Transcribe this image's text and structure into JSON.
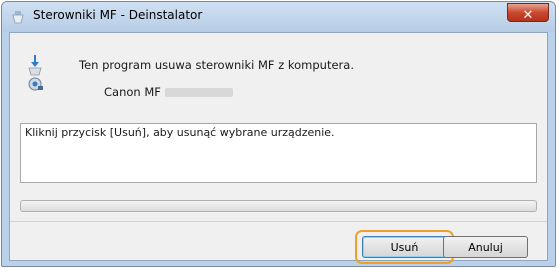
{
  "window": {
    "title": "Sterowniki MF - Deinstalator",
    "close_label": "✕"
  },
  "main": {
    "description": "Ten program usuwa sterowniki MF z komputera.",
    "model_prefix": "Canon MF",
    "message": "Kliknij przycisk [Usuń], aby usunąć wybrane urządzenie.",
    "progress_percent": 0
  },
  "buttons": {
    "ok_label": "Usuń",
    "cancel_label": "Anuluj"
  },
  "colors": {
    "close_button": "#c8492f",
    "highlight": "#f0a02a"
  }
}
